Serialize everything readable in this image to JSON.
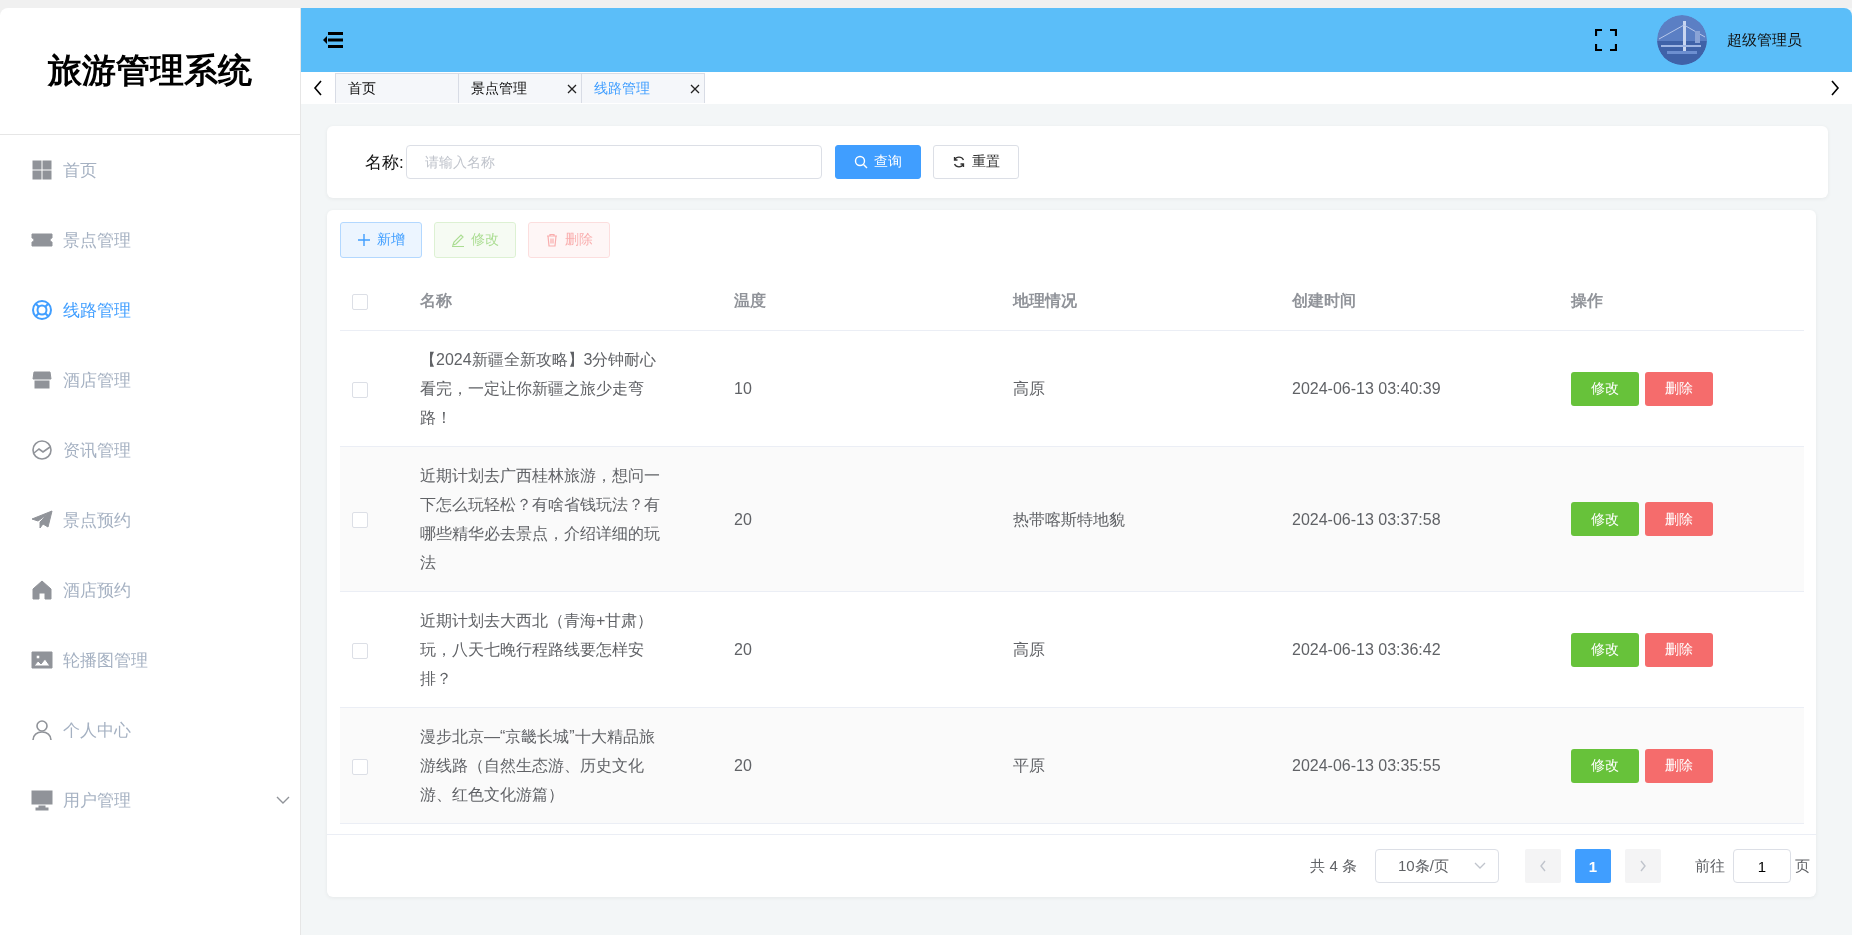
{
  "sidebar": {
    "title": "旅游管理系统",
    "items": [
      {
        "label": "首页",
        "selected": false,
        "kind": "item"
      },
      {
        "label": "景点管理",
        "selected": false,
        "kind": "item"
      },
      {
        "label": "线路管理",
        "selected": true,
        "kind": "item"
      },
      {
        "label": "酒店管理",
        "selected": false,
        "kind": "item"
      },
      {
        "label": "资讯管理",
        "selected": false,
        "kind": "item"
      },
      {
        "label": "景点预约",
        "selected": false,
        "kind": "item"
      },
      {
        "label": "酒店预约",
        "selected": false,
        "kind": "item"
      },
      {
        "label": "轮播图管理",
        "selected": false,
        "kind": "item"
      },
      {
        "label": "个人中心",
        "selected": false,
        "kind": "item"
      },
      {
        "label": "用户管理",
        "selected": false,
        "kind": "submenu"
      }
    ]
  },
  "header": {
    "user": "超级管理员"
  },
  "tabs": [
    {
      "label": "首页",
      "selected": false,
      "closable": false
    },
    {
      "label": "景点管理",
      "selected": false,
      "closable": true
    },
    {
      "label": "线路管理",
      "selected": true,
      "closable": true
    }
  ],
  "search": {
    "label": "名称:",
    "placeholder": "请输入名称",
    "buttons": [
      "查询",
      "重置"
    ]
  },
  "toolbar": [
    {
      "label": "新增",
      "disabled": false
    },
    {
      "label": "修改",
      "disabled": true
    },
    {
      "label": "删除",
      "disabled": true
    }
  ],
  "table": {
    "checked": false,
    "columns": [
      "名称",
      "温度",
      "地理情况",
      "创建时间",
      "操作"
    ],
    "rows": [
      {
        "checked": false,
        "cells": [
          "【2024新疆全新攻略】3分钟耐心看完，一定让你新疆之旅少走弯路！",
          "10",
          "高原",
          "2024-06-13 03:40:39"
        ],
        "actions": [
          "修改",
          "删除"
        ]
      },
      {
        "checked": false,
        "cells": [
          "近期计划去广西桂林旅游，想问一下怎么玩轻松？有啥省钱玩法？有哪些精华必去景点，介绍详细的玩法",
          "20",
          "热带喀斯特地貌",
          "2024-06-13 03:37:58"
        ],
        "actions": [
          "修改",
          "删除"
        ]
      },
      {
        "checked": false,
        "cells": [
          "近期计划去大西北（青海+甘肃）玩，八天七晚行程路线要怎样安排？",
          "20",
          "高原",
          "2024-06-13 03:36:42"
        ],
        "actions": [
          "修改",
          "删除"
        ]
      },
      {
        "checked": false,
        "cells": [
          "漫步北京—“京畿长城”十大精品旅游线路（自然生态游、历史文化游、红色文化游篇）",
          "20",
          "平原",
          "2024-06-13 03:35:55"
        ],
        "actions": [
          "修改",
          "删除"
        ]
      }
    ]
  },
  "pagination": {
    "total": "共 4 条",
    "page_size": "10条/页",
    "prev_disabled": true,
    "next_disabled": true,
    "pages": [
      {
        "label": "1",
        "selected": true
      }
    ],
    "goto_label": "前往",
    "goto_value": "1",
    "goto_suffix": "页"
  }
}
